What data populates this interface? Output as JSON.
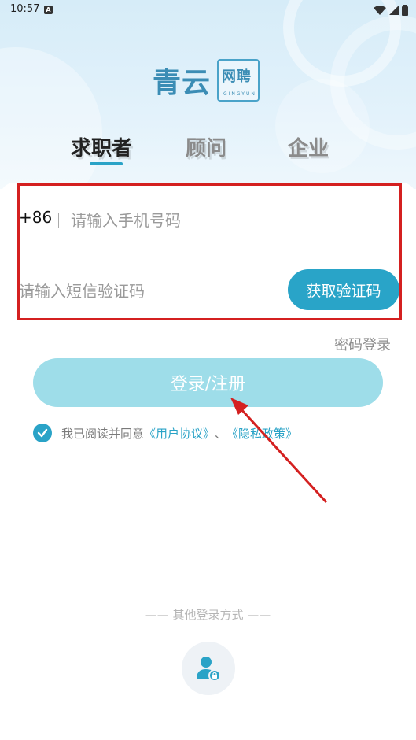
{
  "status_bar": {
    "time": "10:57",
    "notification_badge": "A"
  },
  "logo": {
    "main_text": "青云",
    "sub_text": "网聘",
    "english": "GINGYUN"
  },
  "tabs": [
    {
      "label": "求职者",
      "active": true
    },
    {
      "label": "顾问",
      "active": false
    },
    {
      "label": "企业",
      "active": false
    }
  ],
  "form": {
    "country_code": "+86",
    "phone_placeholder": "请输入手机号码",
    "code_placeholder": "请输入短信验证码",
    "get_code_label": "获取验证码"
  },
  "password_login_label": "密码登录",
  "login_button_label": "登录/注册",
  "agreement": {
    "prefix": "我已阅读并同意",
    "user_agreement": "《用户协议》",
    "separator": "、",
    "privacy_policy": "《隐私政策》",
    "checked": true
  },
  "other_login_label": "—— 其他登录方式 ——",
  "colors": {
    "accent": "#2aa3c7",
    "login_button": "#9edde9",
    "highlight": "#d42020"
  }
}
